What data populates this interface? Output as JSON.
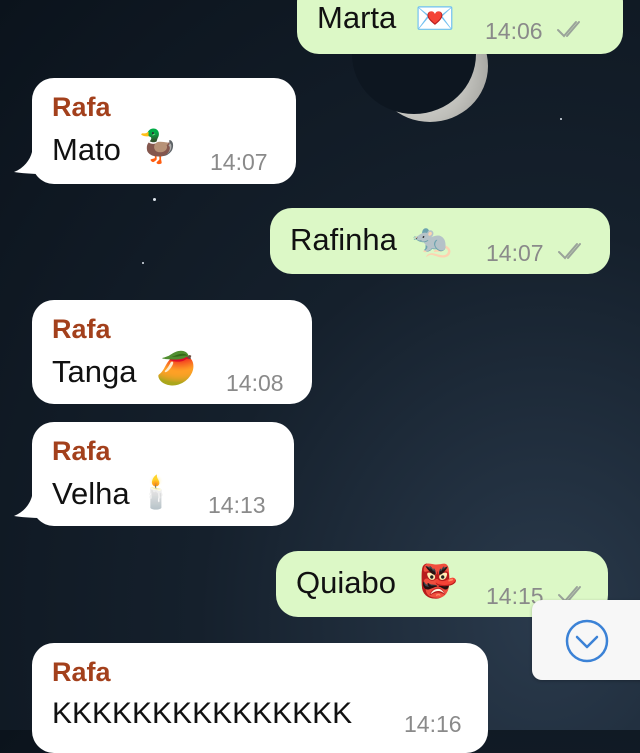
{
  "messages": [
    {
      "direction": "out",
      "text": "Marta",
      "emoji": "💌",
      "emoji_icon": "love-letter-icon",
      "time": "14:06",
      "status": "read"
    },
    {
      "direction": "in",
      "sender": "Rafa",
      "text": "Mato",
      "emoji": "🦆",
      "emoji_icon": "duck-icon",
      "time": "14:07"
    },
    {
      "direction": "out",
      "text": "Rafinha",
      "emoji": "🐀",
      "emoji_icon": "rat-icon",
      "time": "14:07",
      "status": "read"
    },
    {
      "direction": "in",
      "sender": "Rafa",
      "text": "Tanga",
      "emoji": "🥭",
      "emoji_icon": "mango-icon",
      "time": "14:08"
    },
    {
      "direction": "in",
      "sender": "Rafa",
      "text": "Velha",
      "emoji": "🕯️",
      "emoji_icon": "candle-icon",
      "time": "14:13"
    },
    {
      "direction": "out",
      "text": "Quiabo",
      "emoji": "👺",
      "emoji_icon": "goblin-mask-icon",
      "time": "14:15",
      "status": "read"
    },
    {
      "direction": "in",
      "sender": "Rafa",
      "text": "KKKKKKKKKKKKKKK",
      "time": "14:16"
    }
  ],
  "colors": {
    "incoming_bubble": "#ffffff",
    "outgoing_bubble": "#dcf8c6",
    "sender_name": "#a3401c",
    "timestamp": "#8a8a8a",
    "scroll_button_accent": "#3b82d6"
  }
}
